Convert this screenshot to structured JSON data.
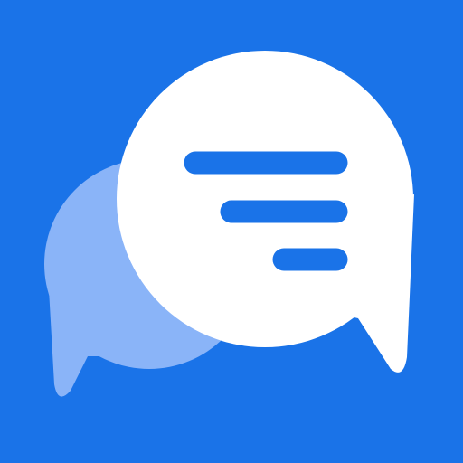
{
  "icon": {
    "name": "chat-bubbles-icon",
    "background_color": "#1a73e8",
    "back_bubble_color": "#8ab4f8",
    "front_bubble_color": "#ffffff",
    "line_color": "#1a73e8"
  }
}
